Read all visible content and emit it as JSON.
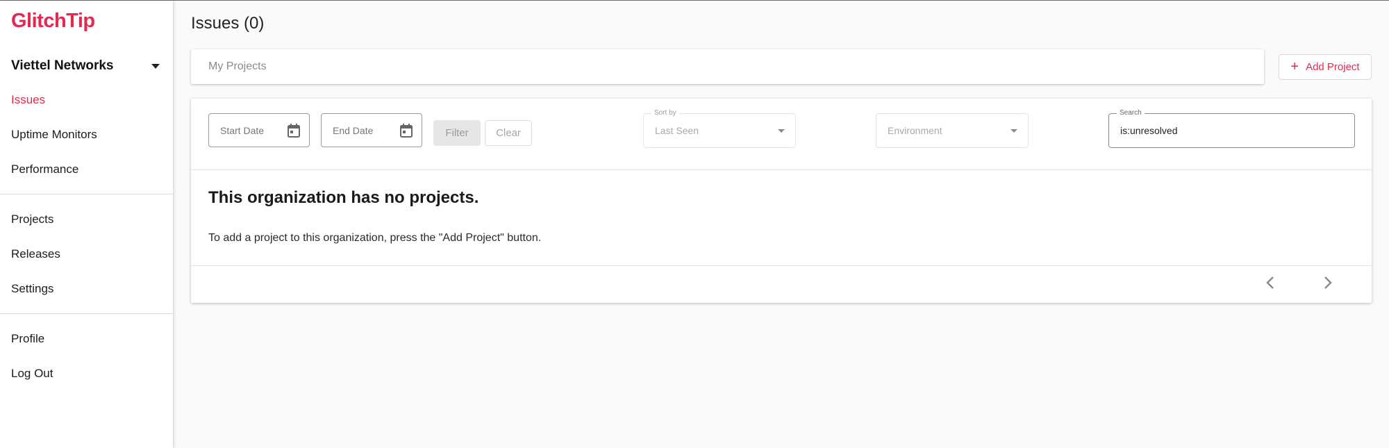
{
  "app": {
    "logo": "GlitchTip",
    "accent": "#e22a4f"
  },
  "sidebar": {
    "org_name": "Viettel Networks",
    "sections": [
      [
        {
          "label": "Issues",
          "active": true
        },
        {
          "label": "Uptime Monitors"
        },
        {
          "label": "Performance"
        }
      ],
      [
        {
          "label": "Projects"
        },
        {
          "label": "Releases"
        },
        {
          "label": "Settings"
        }
      ],
      [
        {
          "label": "Profile"
        },
        {
          "label": "Log Out"
        }
      ]
    ]
  },
  "header": {
    "title": "Issues (0)"
  },
  "projects_select": {
    "placeholder": "My Projects"
  },
  "add_project": {
    "label": "Add Project",
    "icon": "plus-icon"
  },
  "filters": {
    "start_date": {
      "placeholder": "Start Date",
      "icon": "calendar-icon"
    },
    "end_date": {
      "placeholder": "End Date",
      "icon": "calendar-icon"
    },
    "filter_label": "Filter",
    "clear_label": "Clear",
    "sort": {
      "label": "Sort by",
      "value": "Last Seen"
    },
    "environment": {
      "placeholder": "Environment"
    },
    "search": {
      "label": "Search",
      "value": "is:unresolved"
    }
  },
  "empty_state": {
    "title": "This organization has no projects.",
    "message": "To add a project to this organization, press the \"Add Project\" button."
  },
  "pagination": {
    "prev_icon": "chevron-left-icon",
    "next_icon": "chevron-right-icon"
  }
}
